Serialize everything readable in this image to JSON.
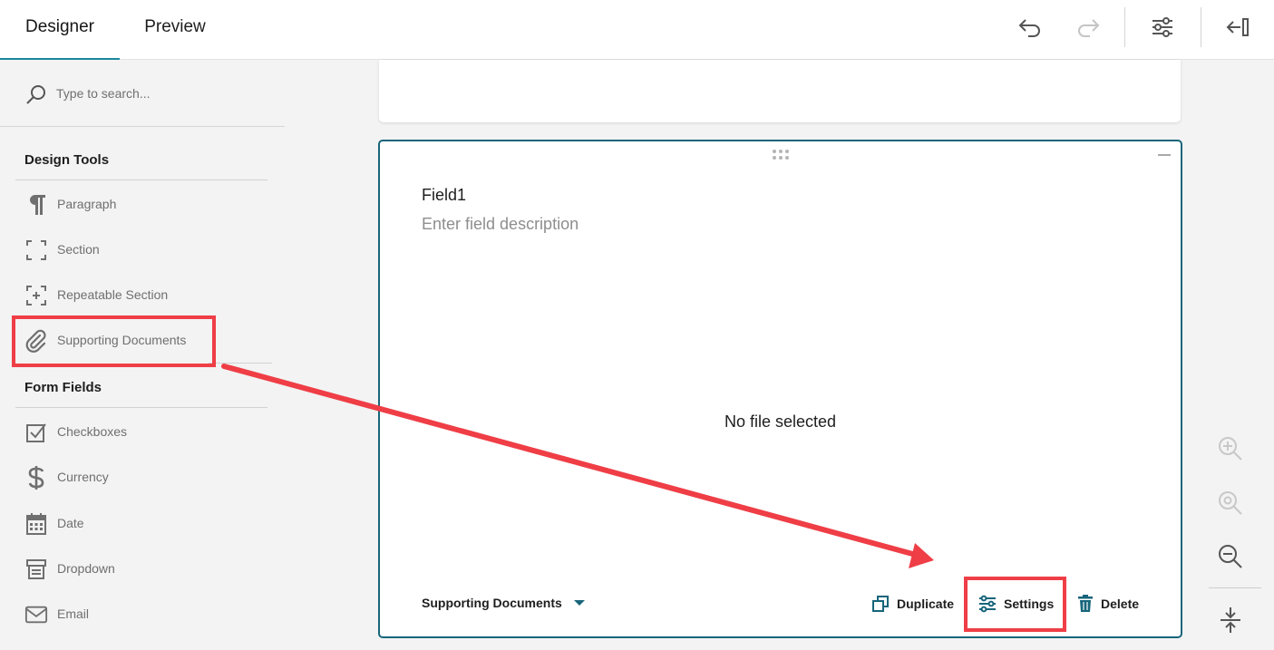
{
  "tabs": {
    "designer": "Designer",
    "preview": "Preview"
  },
  "toolbar": {
    "undo_icon": "undo-icon",
    "redo_icon": "redo-icon",
    "settings_icon": "settings-sliders-icon",
    "collapse_icon": "collapse-panel-icon"
  },
  "sidebar": {
    "search_placeholder": "Type to search...",
    "design_tools_heading": "Design Tools",
    "design_tools": [
      {
        "label": "Paragraph",
        "icon": "paragraph-icon"
      },
      {
        "label": "Section",
        "icon": "section-icon"
      },
      {
        "label": "Repeatable Section",
        "icon": "repeatable-section-icon"
      },
      {
        "label": "Supporting Documents",
        "icon": "paperclip-icon"
      }
    ],
    "form_fields_heading": "Form Fields",
    "form_fields": [
      {
        "label": "Checkboxes",
        "icon": "checkbox-icon"
      },
      {
        "label": "Currency",
        "icon": "dollar-icon"
      },
      {
        "label": "Date",
        "icon": "calendar-icon"
      },
      {
        "label": "Dropdown",
        "icon": "dropdown-icon"
      },
      {
        "label": "Email",
        "icon": "envelope-icon"
      }
    ]
  },
  "field": {
    "title": "Field1",
    "description_placeholder": "Enter field description",
    "empty_state": "No file selected",
    "type_label": "Supporting Documents",
    "actions": {
      "duplicate": "Duplicate",
      "settings": "Settings",
      "delete": "Delete"
    }
  },
  "zoom": {
    "in_icon": "zoom-in-icon",
    "reset_icon": "zoom-reset-icon",
    "out_icon": "zoom-out-icon",
    "fit_icon": "fit-vertical-icon"
  },
  "colors": {
    "accent": "#19889b",
    "card_border": "#17657a",
    "highlight": "#ef3e46",
    "icon_gray": "#6f6f6f"
  }
}
